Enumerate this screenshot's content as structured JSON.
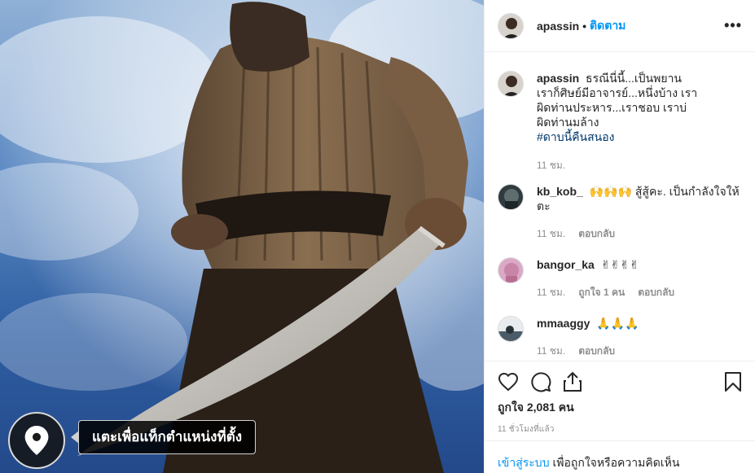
{
  "photo": {
    "location_button_icon": "location-pin-icon",
    "location_tooltip": "แตะเพื่อแท็กตำแหน่งที่ตั้ง"
  },
  "header": {
    "username": "apassin",
    "separator": "•",
    "follow_label": "ติดตาม",
    "more_icon": "more-options-icon",
    "more_label": "•••"
  },
  "caption": {
    "username": "apassin",
    "text": "ธรณีนี่นี้...เป็นพยาน เราก็ศิษย์มีอาจารย์...หนึ่งบ้าง เราผิดท่านประหาร...เราชอบ เราบ่ผิดท่านมล้าง",
    "hashtag": "#ดาบนี้คืนสนอง",
    "time": "11 ชม."
  },
  "comments": [
    {
      "username": "kb_kob_",
      "text": "🙌🙌🙌 สู้สู้คะ. เป็นกำลังใจให้ตะ",
      "time": "11 ชม.",
      "likes": "",
      "reply_label": "ตอบกลับ"
    },
    {
      "username": "bangor_ka",
      "text": "✌✌✌✌",
      "time": "11 ชม.",
      "likes": "ถูกใจ 1 คน",
      "reply_label": "ตอบกลับ"
    },
    {
      "username": "mmaaggy",
      "text": "🙏🙏🙏",
      "time": "11 ชม.",
      "likes": "",
      "reply_label": "ตอบกลับ"
    }
  ],
  "actions": {
    "like_icon": "heart-icon",
    "comment_icon": "comment-icon",
    "share_icon": "share-icon",
    "save_icon": "bookmark-icon",
    "likes_text": "ถูกใจ 2,081 คน",
    "timestamp": "11 ชั่วโมงที่แล้ว"
  },
  "login": {
    "link_text": "เข้าสู่ระบบ",
    "rest_text": " เพื่อถูกใจหรือความคิดเห็น"
  },
  "colors": {
    "accent": "#0095f6",
    "hashtag": "#00376b",
    "muted": "#8e8e8e"
  }
}
